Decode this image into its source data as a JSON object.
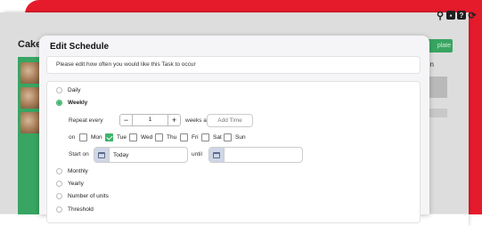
{
  "app": {
    "title": "Cake",
    "button_label": "plate",
    "column_label": "on"
  },
  "modal": {
    "title": "Edit Schedule",
    "intro": "Please edit how often you would like this Task to occur",
    "options": [
      {
        "label": "Daily",
        "selected": false
      },
      {
        "label": "Weekly",
        "selected": true
      },
      {
        "label": "Monthly",
        "selected": false
      },
      {
        "label": "Yearly",
        "selected": false
      },
      {
        "label": "Number of units",
        "selected": false
      },
      {
        "label": "Threshold",
        "selected": false
      }
    ],
    "repeat_every_label": "Repeat every",
    "repeat_value": "1",
    "weeks_at_label": "weeks at",
    "add_time_label": "Add Time",
    "on_label": "on",
    "days": [
      {
        "label": "Mon",
        "checked": false
      },
      {
        "label": "Tue",
        "checked": true
      },
      {
        "label": "Wed",
        "checked": false
      },
      {
        "label": "Thu",
        "checked": false
      },
      {
        "label": "Fri",
        "checked": false
      },
      {
        "label": "Sat",
        "checked": false
      },
      {
        "label": "Sun",
        "checked": false
      }
    ],
    "start_on_label": "Start on",
    "start_value": "Today",
    "until_label": "until",
    "until_value": ""
  },
  "colors": {
    "accent_green": "#3db36b",
    "brand_red": "#e51b2c"
  },
  "icons": [
    "search-icon",
    "notification-icon",
    "help-icon",
    "refresh-icon",
    "calendar-icon"
  ]
}
